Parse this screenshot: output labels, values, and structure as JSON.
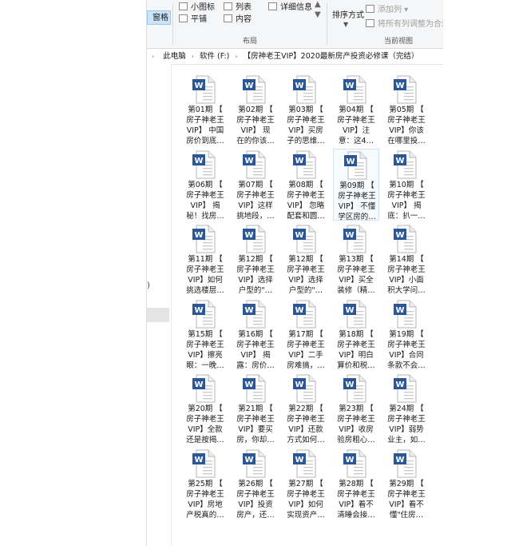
{
  "ribbon": {
    "preview_pane": "窗格",
    "small_icons": "小图标",
    "list": "列表",
    "details": "详细信息",
    "tiles": "平铺",
    "content": "内容",
    "sort_by": "排序方式",
    "add_column": "添加列",
    "fit_columns": "将所有列调整为合适",
    "layout_label": "布局",
    "current_view_label": "当前视图"
  },
  "address": {
    "crumbs": [
      "此电脑",
      "软件 (F:)",
      "【房神老王VIP】2020最新房产投资必修课（完结）"
    ]
  },
  "nav": {
    "paren": ")"
  },
  "files": [
    {
      "lines": [
        "第01期 【",
        "房子神老王",
        "VIP】 中国",
        "房价到底…"
      ]
    },
    {
      "lines": [
        "第02期 【",
        "房子神老王",
        "VIP】 现",
        "在的你该…"
      ]
    },
    {
      "lines": [
        "第03期 【",
        "房子神老王",
        "VIP】买房",
        "子的思维…"
      ]
    },
    {
      "lines": [
        "第04期 【",
        "房子神老王",
        "VIP】注",
        "意：这4…"
      ]
    },
    {
      "lines": [
        "第05期 【",
        "房子神老王",
        "VIP】你该",
        "在哪里投…"
      ]
    },
    {
      "lines": [
        "第06期 【",
        "房子神老王",
        "VIP】 揭",
        "秘！找房…"
      ]
    },
    {
      "lines": [
        "第07期 【",
        "房子神老王",
        "VIP】这样",
        "挑地段，…"
      ]
    },
    {
      "lines": [
        "第08期 【",
        "房子神老王",
        "VIP】 忽略",
        "配套和圆…"
      ]
    },
    {
      "lines": [
        "第09期 【",
        "房子神老王",
        "VIP】 不懂",
        "学区房的…"
      ],
      "selected": true
    },
    {
      "lines": [
        "第10期 【",
        "房子神老王",
        "VIP】 揭",
        "底：扒一…"
      ]
    },
    {
      "lines": [
        "第11期 【",
        "房子神老王",
        "VIP】如何",
        "挑选楼层…"
      ]
    },
    {
      "lines": [
        "第12期 【",
        "房子神老王",
        "VIP】选择",
        "户型的\"…"
      ]
    },
    {
      "lines": [
        "第12期 【",
        "房子神老王",
        "VIP】选择",
        "户型的\"…"
      ]
    },
    {
      "lines": [
        "第13期 【",
        "房子神老王",
        "VIP】买全",
        "装修（精…"
      ]
    },
    {
      "lines": [
        "第14期 【",
        "房子神老王",
        "VIP】小面",
        "积大学问…"
      ]
    },
    {
      "lines": [
        "第15期 【",
        "房子神老王",
        "VIP】擦亮",
        "眼：一晚…"
      ]
    },
    {
      "lines": [
        "第16期 【",
        "房子神老王",
        "VIP】 揭",
        "露：房价…"
      ]
    },
    {
      "lines": [
        "第17期 【",
        "房子神老王",
        "VIP】二手",
        "房难搞，…"
      ]
    },
    {
      "lines": [
        "第18期 【",
        "房子神老王",
        "VIP】明白",
        "算价和税…"
      ]
    },
    {
      "lines": [
        "第19期 【",
        "房子神老王",
        "VIP】合同",
        "条款不会…"
      ]
    },
    {
      "lines": [
        "第20期 【",
        "房子神老王",
        "VIP】全款",
        "还是按揭…"
      ]
    },
    {
      "lines": [
        "第21期 【",
        "房子神老王",
        "VIP】要买",
        "房，你却…"
      ]
    },
    {
      "lines": [
        "第22期 【",
        "房子神老王",
        "VIP】还款",
        "方式如何…"
      ]
    },
    {
      "lines": [
        "第23期 【",
        "房子神老王",
        "VIP】收房",
        "验房粗心…"
      ]
    },
    {
      "lines": [
        "第24期 【",
        "房子神老王",
        "VIP】弱势",
        "业主，如…"
      ]
    },
    {
      "lines": [
        "第25期 【",
        "房子神老王",
        "VIP】房地",
        "产税真的…"
      ]
    },
    {
      "lines": [
        "第26期 【",
        "房子神老王",
        "VIP】投资",
        "房产，还…"
      ]
    },
    {
      "lines": [
        "第27期 【",
        "房子神老王",
        "VIP】如何",
        "实现资产…"
      ]
    },
    {
      "lines": [
        "第28期 【",
        "房子神老王",
        "VIP】看不",
        "清睡会接…"
      ]
    },
    {
      "lines": [
        "第29期 【",
        "房子神老王",
        "VIP】看不",
        "懂\"住房…"
      ]
    }
  ],
  "colors": {
    "doc_blue": "#2b5797",
    "selection": "#cfe4f7"
  }
}
